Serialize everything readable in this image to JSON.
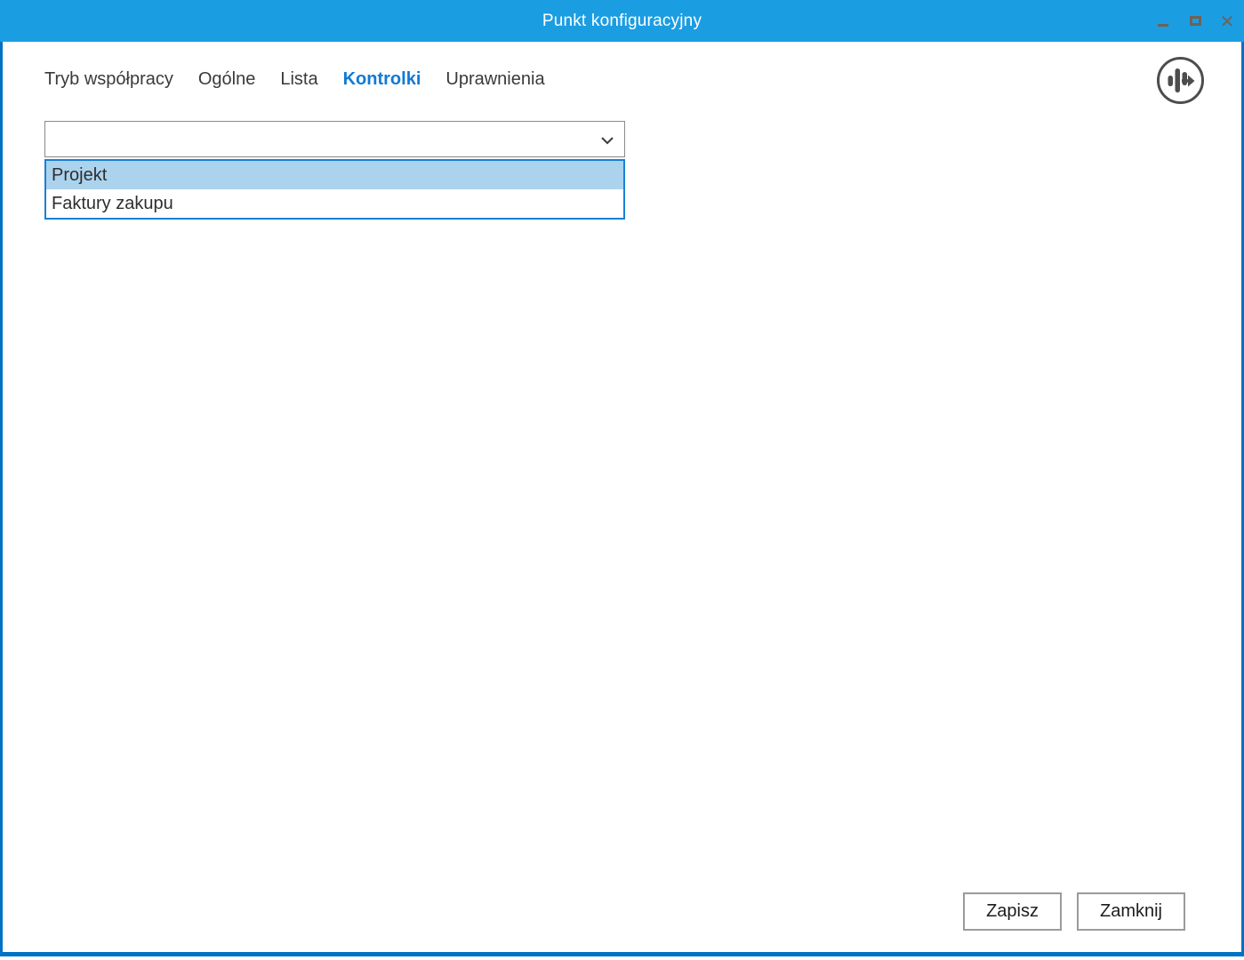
{
  "window": {
    "title": "Punkt konfiguracyjny"
  },
  "titlebar": {
    "controls": [
      {
        "name": "minimize-icon"
      },
      {
        "name": "maximize-icon"
      },
      {
        "name": "close-icon"
      }
    ]
  },
  "tabs": [
    {
      "label": "Tryb współpracy",
      "active": false
    },
    {
      "label": "Ogólne",
      "active": false
    },
    {
      "label": "Lista",
      "active": false
    },
    {
      "label": "Kontrolki",
      "active": true
    },
    {
      "label": "Uprawnienia",
      "active": false
    }
  ],
  "combobox": {
    "value": "",
    "placeholder": "",
    "chevron_icon": "chevron-down-icon",
    "options": [
      {
        "label": "Projekt",
        "highlighted": true
      },
      {
        "label": "Faktury zakupu",
        "highlighted": false
      }
    ]
  },
  "corner_icon": "levels-arrow-icon",
  "footer": {
    "save_label": "Zapisz",
    "close_label": "Zamknij"
  },
  "colors": {
    "titlebar_blue": "#1b9de2",
    "frame_blue": "#0071c5",
    "accent_blue": "#0f7ad6",
    "dropdown_border_blue": "#1a7fd4",
    "highlight_blue": "#abd3ee"
  }
}
